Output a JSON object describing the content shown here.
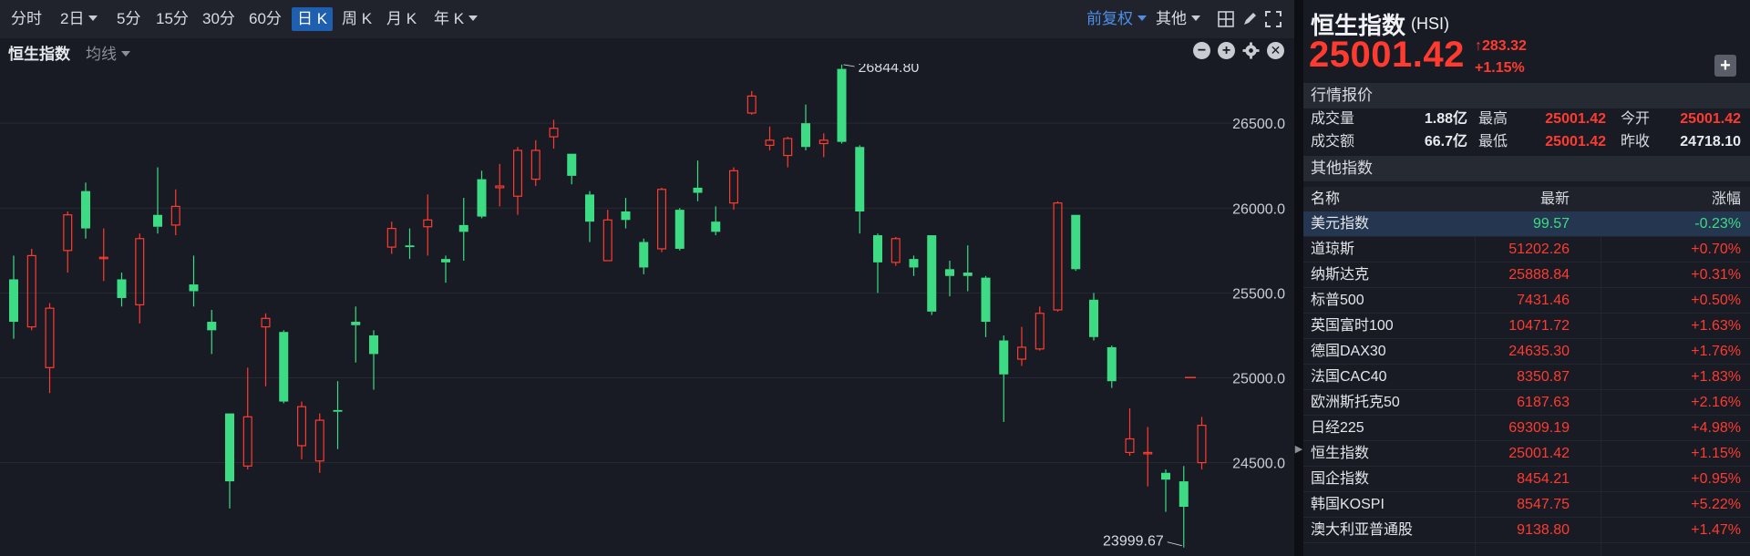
{
  "toolbar": {
    "periods": [
      "分时",
      "2日",
      "5分",
      "15分",
      "30分",
      "60分",
      "日 K",
      "周 K",
      "月 K",
      "年 K"
    ],
    "active_period": "日 K",
    "adjust": "前复权",
    "other": "其他"
  },
  "subbar": {
    "title": "恒生指数",
    "ma": "均线"
  },
  "quote": {
    "name": "恒生指数",
    "code": "(HSI)",
    "price": "25001.42",
    "change": "283.32",
    "change_pct": "+1.15%",
    "section_quote": "行情报价",
    "stats": {
      "volume_label": "成交量",
      "volume": "1.88亿",
      "high_label": "最高",
      "high": "25001.42",
      "open_label": "今开",
      "open": "25001.42",
      "amount_label": "成交额",
      "amount": "66.7亿",
      "low_label": "最低",
      "low": "25001.42",
      "prev_close_label": "昨收",
      "prev_close": "24718.10"
    },
    "section_other": "其他指数",
    "table_headers": [
      "名称",
      "最新",
      "涨幅"
    ],
    "indices": [
      {
        "name": "美元指数",
        "last": "99.57",
        "pct": "-0.23%"
      },
      {
        "name": "道琼斯",
        "last": "51202.26",
        "pct": "+0.70%"
      },
      {
        "name": "纳斯达克",
        "last": "25888.84",
        "pct": "+0.31%"
      },
      {
        "name": "标普500",
        "last": "7431.46",
        "pct": "+0.50%"
      },
      {
        "name": "英国富时100",
        "last": "10471.72",
        "pct": "+1.63%"
      },
      {
        "name": "德国DAX30",
        "last": "24635.30",
        "pct": "+1.76%"
      },
      {
        "name": "法国CAC40",
        "last": "8350.87",
        "pct": "+1.83%"
      },
      {
        "name": "欧洲斯托克50",
        "last": "6187.63",
        "pct": "+2.16%"
      },
      {
        "name": "日经225",
        "last": "69309.19",
        "pct": "+4.98%"
      },
      {
        "name": "恒生指数",
        "last": "25001.42",
        "pct": "+1.15%"
      },
      {
        "name": "国企指数",
        "last": "8454.21",
        "pct": "+0.95%"
      },
      {
        "name": "韩国KOSPI",
        "last": "8547.75",
        "pct": "+5.22%"
      },
      {
        "name": "澳大利亚普通股",
        "last": "9138.80",
        "pct": "+1.47%"
      }
    ]
  },
  "colors": {
    "up": "#ff3b30",
    "down": "#3ddc84",
    "accent": "#1f5fb0",
    "bg": "#181b23"
  },
  "chart_data": {
    "type": "candlestick",
    "y_ticks": [
      24500,
      25000,
      25500,
      26000,
      26500
    ],
    "ylim": [
      23950,
      26850
    ],
    "y_tick_labels": [
      "24500.0",
      "25000.0",
      "25500.0",
      "26000.0",
      "26500.0"
    ],
    "max_label": "26844.80",
    "min_label": "23999.67",
    "last_close_marker": 25001.42,
    "candles": [
      {
        "o": 25580,
        "c": 25330,
        "h": 25720,
        "l": 25230
      },
      {
        "o": 25300,
        "c": 25720,
        "h": 25760,
        "l": 25280
      },
      {
        "o": 25060,
        "c": 25410,
        "h": 25440,
        "l": 24910
      },
      {
        "o": 25750,
        "c": 25960,
        "h": 25980,
        "l": 25620
      },
      {
        "o": 26100,
        "c": 25880,
        "h": 26150,
        "l": 25820
      },
      {
        "o": 25710,
        "c": 25710,
        "h": 25880,
        "l": 25570
      },
      {
        "o": 25580,
        "c": 25470,
        "h": 25620,
        "l": 25420
      },
      {
        "o": 25430,
        "c": 25820,
        "h": 25850,
        "l": 25320
      },
      {
        "o": 25960,
        "c": 25890,
        "h": 26240,
        "l": 25850
      },
      {
        "o": 25900,
        "c": 26010,
        "h": 26110,
        "l": 25840
      },
      {
        "o": 25550,
        "c": 25510,
        "h": 25720,
        "l": 25420
      },
      {
        "o": 25330,
        "c": 25280,
        "h": 25400,
        "l": 25140
      },
      {
        "o": 24790,
        "c": 24390,
        "h": 24790,
        "l": 24230
      },
      {
        "o": 24480,
        "c": 24770,
        "h": 25060,
        "l": 24460
      },
      {
        "o": 25300,
        "c": 25350,
        "h": 25380,
        "l": 24950
      },
      {
        "o": 25270,
        "c": 24860,
        "h": 25280,
        "l": 24850
      },
      {
        "o": 24600,
        "c": 24830,
        "h": 24860,
        "l": 24520
      },
      {
        "o": 24510,
        "c": 24750,
        "h": 24790,
        "l": 24440
      },
      {
        "o": 24810,
        "c": 24800,
        "h": 24980,
        "l": 24580
      },
      {
        "o": 25330,
        "c": 25310,
        "h": 25420,
        "l": 25090
      },
      {
        "o": 25250,
        "c": 25140,
        "h": 25280,
        "l": 24930
      },
      {
        "o": 25770,
        "c": 25880,
        "h": 25920,
        "l": 25730
      },
      {
        "o": 25780,
        "c": 25770,
        "h": 25880,
        "l": 25700
      },
      {
        "o": 25890,
        "c": 25930,
        "h": 26080,
        "l": 25720
      },
      {
        "o": 25700,
        "c": 25680,
        "h": 25720,
        "l": 25560
      },
      {
        "o": 25900,
        "c": 25860,
        "h": 26060,
        "l": 25690
      },
      {
        "o": 26170,
        "c": 25950,
        "h": 26220,
        "l": 25940
      },
      {
        "o": 26120,
        "c": 26130,
        "h": 26260,
        "l": 26010
      },
      {
        "o": 26070,
        "c": 26340,
        "h": 26360,
        "l": 25960
      },
      {
        "o": 26170,
        "c": 26340,
        "h": 26400,
        "l": 26130
      },
      {
        "o": 26420,
        "c": 26470,
        "h": 26520,
        "l": 26350
      },
      {
        "o": 26320,
        "c": 26190,
        "h": 26320,
        "l": 26140
      },
      {
        "o": 26080,
        "c": 25920,
        "h": 26100,
        "l": 25800
      },
      {
        "o": 25690,
        "c": 25930,
        "h": 25990,
        "l": 25690
      },
      {
        "o": 25980,
        "c": 25930,
        "h": 26060,
        "l": 25880
      },
      {
        "o": 25800,
        "c": 25650,
        "h": 25820,
        "l": 25610
      },
      {
        "o": 25760,
        "c": 26110,
        "h": 26120,
        "l": 25740
      },
      {
        "o": 25990,
        "c": 25760,
        "h": 26000,
        "l": 25750
      },
      {
        "o": 26120,
        "c": 26090,
        "h": 26280,
        "l": 26040
      },
      {
        "o": 25920,
        "c": 25860,
        "h": 26010,
        "l": 25840
      },
      {
        "o": 26030,
        "c": 26220,
        "h": 26240,
        "l": 25990
      },
      {
        "o": 26560,
        "c": 26660,
        "h": 26690,
        "l": 26550
      },
      {
        "o": 26370,
        "c": 26400,
        "h": 26480,
        "l": 26340
      },
      {
        "o": 26310,
        "c": 26410,
        "h": 26420,
        "l": 26240
      },
      {
        "o": 26500,
        "c": 26360,
        "h": 26610,
        "l": 26340
      },
      {
        "o": 26380,
        "c": 26400,
        "h": 26440,
        "l": 26300
      },
      {
        "o": 26820,
        "c": 26390,
        "h": 26845,
        "l": 26380
      },
      {
        "o": 26360,
        "c": 25980,
        "h": 26370,
        "l": 25850
      },
      {
        "o": 25840,
        "c": 25680,
        "h": 25850,
        "l": 25500
      },
      {
        "o": 25680,
        "c": 25820,
        "h": 25830,
        "l": 25660
      },
      {
        "o": 25700,
        "c": 25650,
        "h": 25720,
        "l": 25600
      },
      {
        "o": 25840,
        "c": 25390,
        "h": 25840,
        "l": 25370
      },
      {
        "o": 25640,
        "c": 25600,
        "h": 25690,
        "l": 25480
      },
      {
        "o": 25620,
        "c": 25600,
        "h": 25780,
        "l": 25510
      },
      {
        "o": 25590,
        "c": 25330,
        "h": 25600,
        "l": 25240
      },
      {
        "o": 25220,
        "c": 25020,
        "h": 25250,
        "l": 24740
      },
      {
        "o": 25110,
        "c": 25180,
        "h": 25300,
        "l": 25070
      },
      {
        "o": 25170,
        "c": 25380,
        "h": 25420,
        "l": 25160
      },
      {
        "o": 25400,
        "c": 26030,
        "h": 26040,
        "l": 25390
      },
      {
        "o": 25960,
        "c": 25640,
        "h": 25960,
        "l": 25630
      },
      {
        "o": 25460,
        "c": 25240,
        "h": 25500,
        "l": 25220
      },
      {
        "o": 25180,
        "c": 24980,
        "h": 25190,
        "l": 24940
      },
      {
        "o": 24560,
        "c": 24640,
        "h": 24820,
        "l": 24540
      },
      {
        "o": 24560,
        "c": 24560,
        "h": 24710,
        "l": 24360
      },
      {
        "o": 24440,
        "c": 24400,
        "h": 24460,
        "l": 24210
      },
      {
        "o": 24390,
        "c": 24240,
        "h": 24480,
        "l": 24000
      },
      {
        "o": 24500,
        "c": 24720,
        "h": 24770,
        "l": 24460
      }
    ]
  }
}
